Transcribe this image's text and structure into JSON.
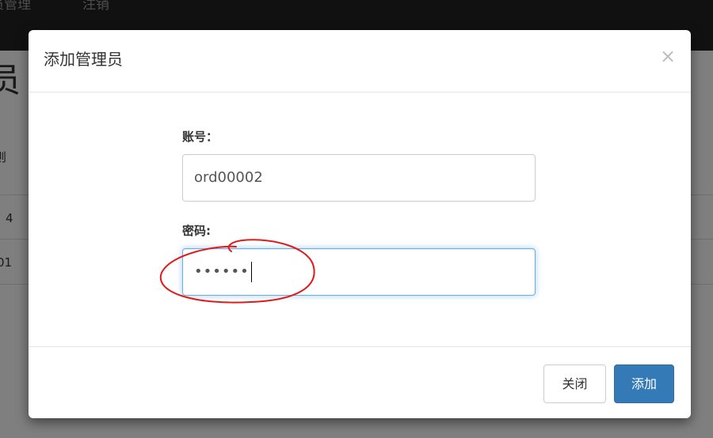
{
  "background": {
    "nav": {
      "admin_link": "员管理",
      "logout_link": "注销"
    },
    "heading_fragment": "员",
    "table_header_fragment": "员则",
    "rows": [
      "4",
      "01"
    ]
  },
  "modal": {
    "title": "添加管理员",
    "close_symbol": "×",
    "account_label": "账号：",
    "account_value": "ord00002",
    "password_label": "密码:",
    "password_masked": "••••••",
    "close_button": "关闭",
    "add_button": "添加"
  }
}
